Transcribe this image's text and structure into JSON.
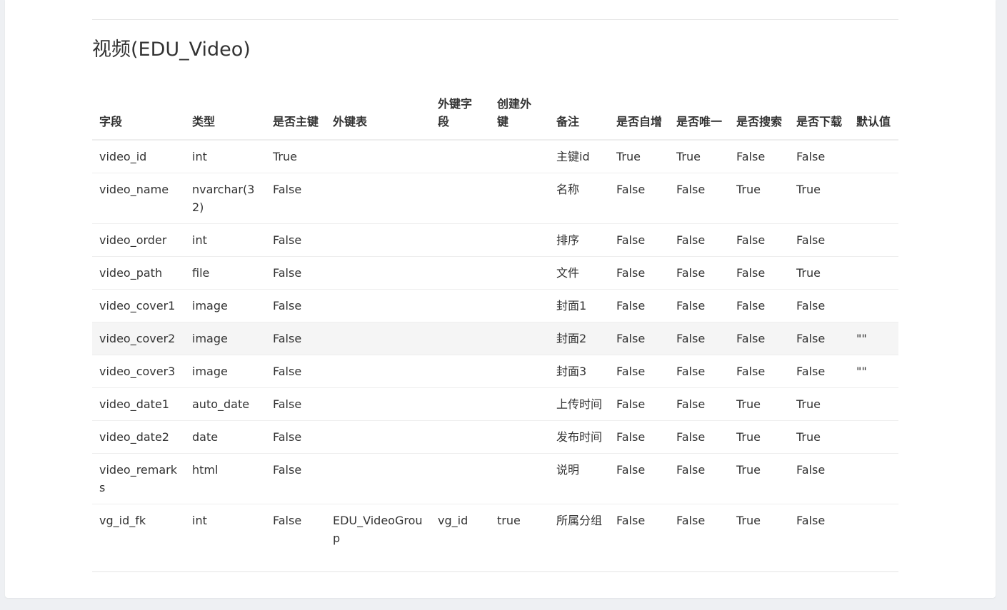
{
  "page": {
    "title": "视频(EDU_Video)"
  },
  "table": {
    "columns": [
      "字段",
      "类型",
      "是否主键",
      "外键表",
      "外键字段",
      "创建外键",
      "备注",
      "是否自增",
      "是否唯一",
      "是否搜索",
      "是否下载",
      "默认值"
    ],
    "rows": [
      [
        "video_id",
        "int",
        "True",
        "",
        "",
        "",
        "主键id",
        "True",
        "True",
        "False",
        "False",
        ""
      ],
      [
        "video_name",
        "nvarchar(32)",
        "False",
        "",
        "",
        "",
        "名称",
        "False",
        "False",
        "True",
        "True",
        ""
      ],
      [
        "video_order",
        "int",
        "False",
        "",
        "",
        "",
        "排序",
        "False",
        "False",
        "False",
        "False",
        ""
      ],
      [
        "video_path",
        "file",
        "False",
        "",
        "",
        "",
        "文件",
        "False",
        "False",
        "False",
        "True",
        ""
      ],
      [
        "video_cover1",
        "image",
        "False",
        "",
        "",
        "",
        "封面1",
        "False",
        "False",
        "False",
        "False",
        ""
      ],
      [
        "video_cover2",
        "image",
        "False",
        "",
        "",
        "",
        "封面2",
        "False",
        "False",
        "False",
        "False",
        "\"\""
      ],
      [
        "video_cover3",
        "image",
        "False",
        "",
        "",
        "",
        "封面3",
        "False",
        "False",
        "False",
        "False",
        "\"\""
      ],
      [
        "video_date1",
        "auto_date",
        "False",
        "",
        "",
        "",
        "上传时间",
        "False",
        "False",
        "True",
        "True",
        ""
      ],
      [
        "video_date2",
        "date",
        "False",
        "",
        "",
        "",
        "发布时间",
        "False",
        "False",
        "True",
        "True",
        ""
      ],
      [
        "video_remarks",
        "html",
        "False",
        "",
        "",
        "",
        "说明",
        "False",
        "False",
        "True",
        "False",
        ""
      ],
      [
        "vg_id_fk",
        "int",
        "False",
        "EDU_VideoGroup",
        "vg_id",
        "true",
        "所属分组",
        "False",
        "False",
        "True",
        "False",
        ""
      ]
    ],
    "highlighted_row": 5
  },
  "colors": {
    "background": "#eef0f3",
    "card": "#ffffff",
    "text": "#333333",
    "border": "#eeeeee",
    "row_highlight": "#f5f5f5"
  }
}
